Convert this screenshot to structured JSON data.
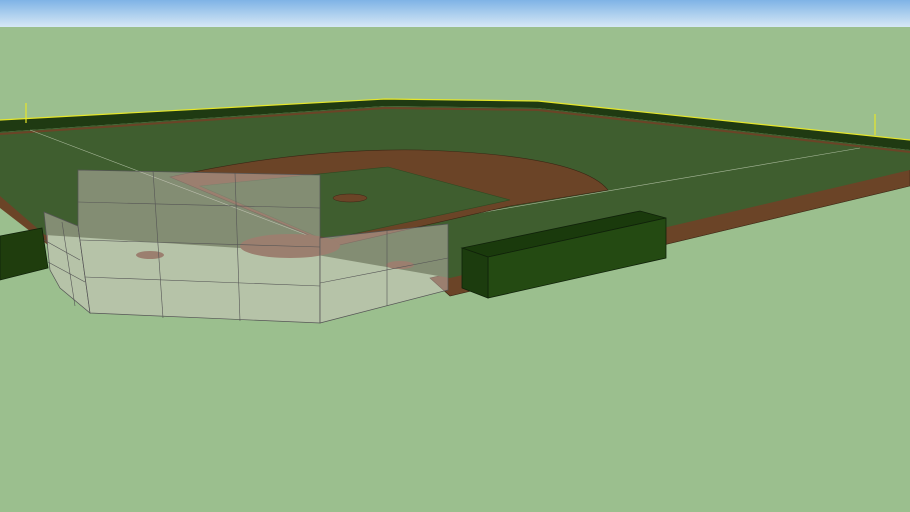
{
  "colors": {
    "sky_top": "#7fb3e6",
    "sky_bottom": "#d6e8f5",
    "ground": "#9bbf8e",
    "grass": "#3f5e2f",
    "wall": "#1f3a12",
    "wall_cap": "#e6e62a",
    "dirt": "#6b4427",
    "dugout_top": "#1a3a0c",
    "dugout_front": "#244a12",
    "netting": "#c8c8c8"
  }
}
